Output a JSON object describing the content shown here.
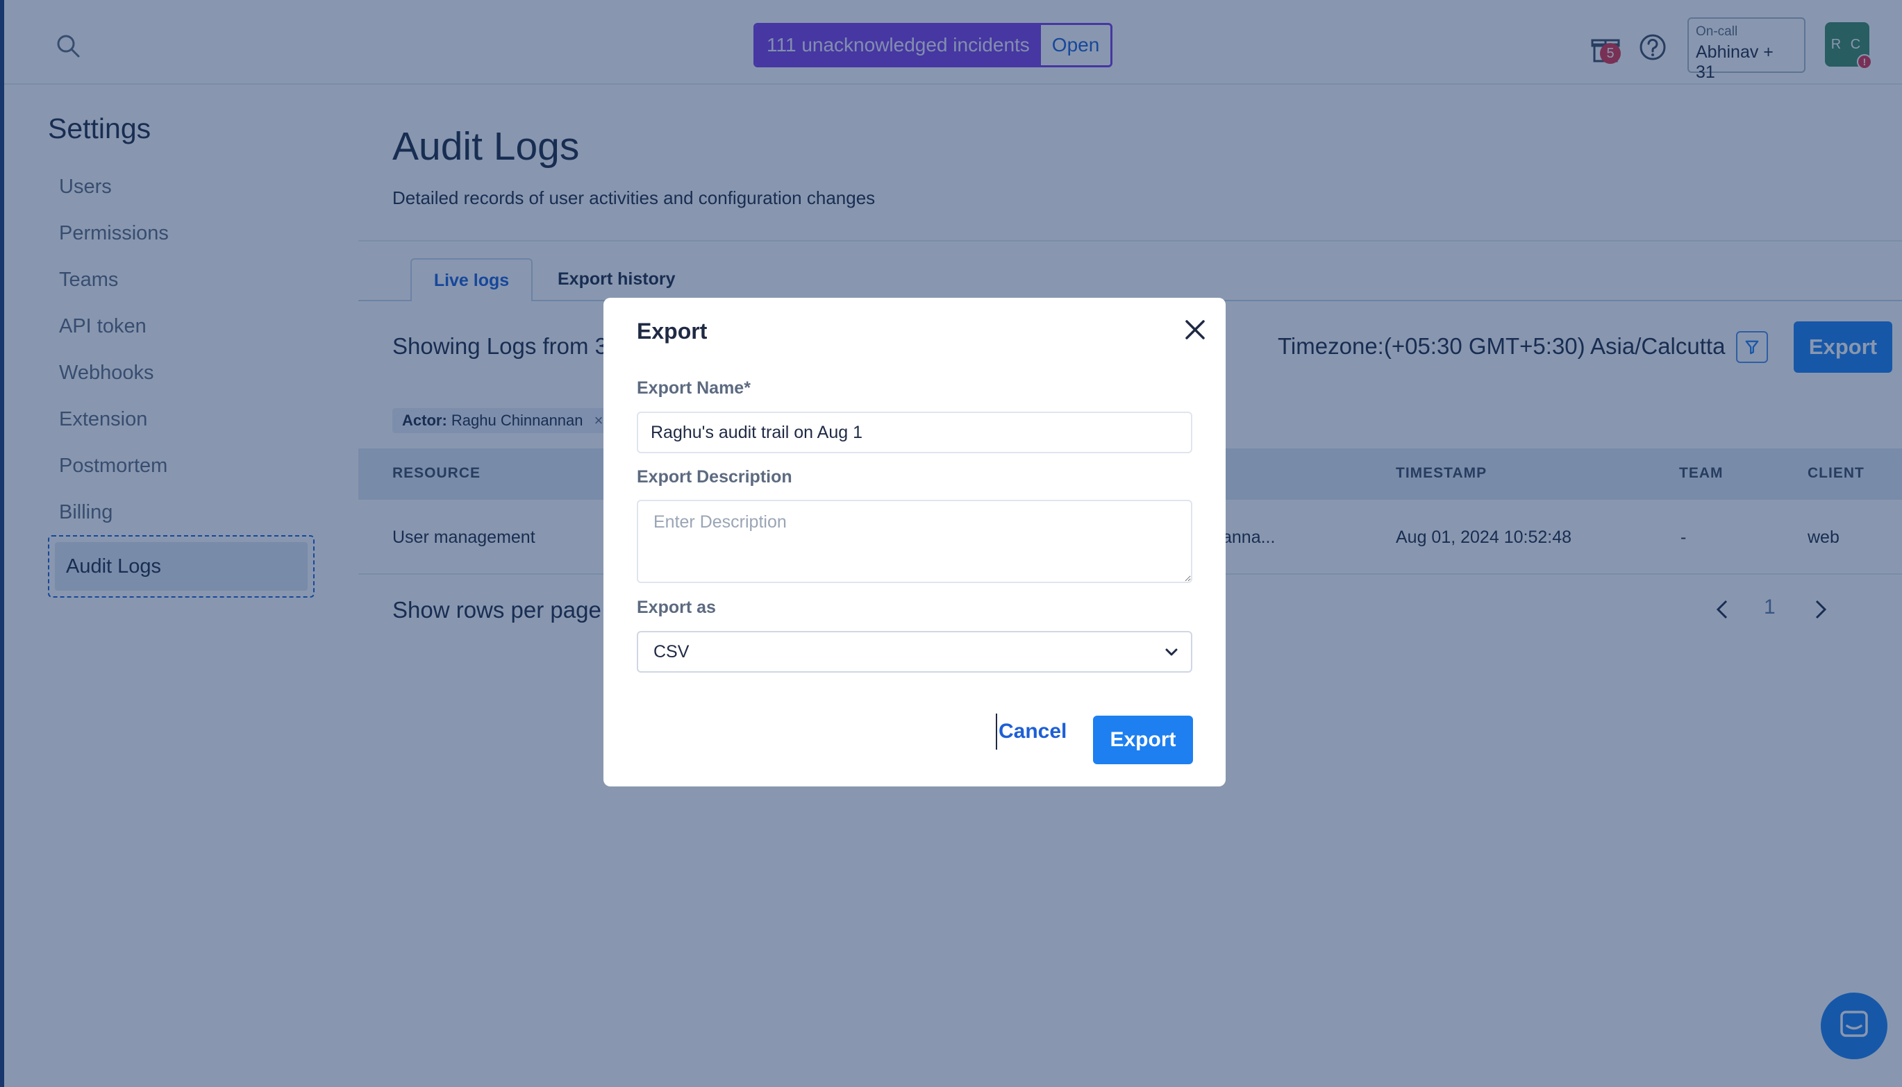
{
  "topbar": {
    "search_icon": "search-icon",
    "incident_banner": {
      "text": "111 unacknowledged incidents",
      "open_label": "Open"
    },
    "gift_badge_count": "5",
    "oncall": {
      "label": "On-call",
      "name": "Abhinav + 31"
    },
    "avatar_initials": "R C",
    "avatar_badge": "!"
  },
  "sidebar": {
    "title": "Settings",
    "items": [
      {
        "label": "Users"
      },
      {
        "label": "Permissions"
      },
      {
        "label": "Teams"
      },
      {
        "label": "API token"
      },
      {
        "label": "Webhooks"
      },
      {
        "label": "Extension"
      },
      {
        "label": "Postmortem"
      },
      {
        "label": "Billing"
      },
      {
        "label": "Audit Logs",
        "active": true
      }
    ]
  },
  "main": {
    "title": "Audit Logs",
    "subtitle": "Detailed records of user activities and configuration changes",
    "tabs": [
      {
        "label": "Live logs",
        "active": true
      },
      {
        "label": "Export history"
      }
    ],
    "showing_text": "Showing Logs from 3",
    "timezone_text": "Timezone:(+05:30 GMT+5:30) Asia/Calcutta",
    "export_label": "Export",
    "filter_chip": {
      "key": "Actor:",
      "value": "Raghu Chinnannan",
      "remove": "×"
    },
    "table": {
      "headers": [
        "RESOURCE",
        "TIMESTAMP",
        "TEAM",
        "CLIENT"
      ],
      "row": {
        "resource": "User management",
        "actor": "anna...",
        "timestamp": "Aug 01, 2024 10:52:48",
        "team": "-",
        "client": "web"
      }
    },
    "rows_per_page_label": "Show rows per page",
    "pagination": {
      "current": "1"
    }
  },
  "modal": {
    "title": "Export",
    "name_label": "Export Name*",
    "name_value": "Raghu's audit trail on Aug 1",
    "description_label": "Export Description",
    "description_placeholder": "Enter Description",
    "format_label": "Export as",
    "format_value": "CSV",
    "cancel_label": "Cancel",
    "export_label": "Export"
  },
  "colors": {
    "accent": "#1d7ff0",
    "incident_purple": "#7b3fe4",
    "overlay": "#11305f"
  }
}
